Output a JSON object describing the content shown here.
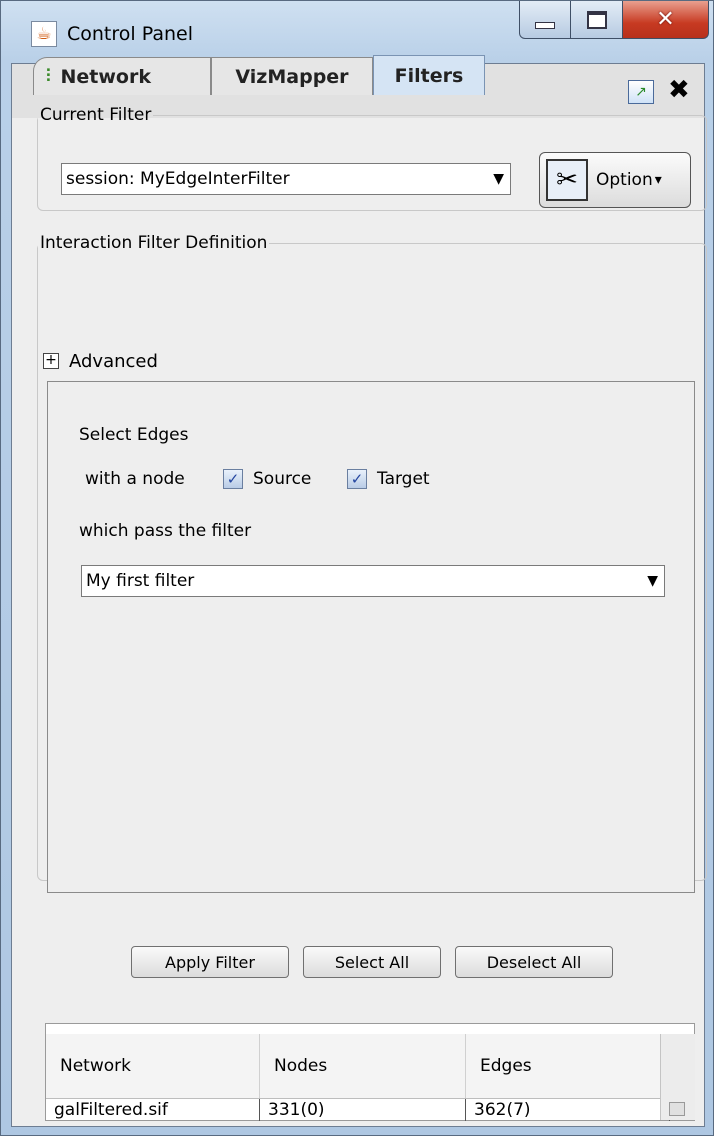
{
  "window": {
    "title": "Control Panel",
    "icon": "java-cup-icon",
    "controls": {
      "minimize": "minimize-icon",
      "maximize": "maximize-icon",
      "close": "✕"
    }
  },
  "panel": {
    "dock_icon": "undock-icon",
    "close_glyph": "✖"
  },
  "tabs": [
    {
      "label": "Network",
      "icon": "network-tree-icon",
      "active": false
    },
    {
      "label": "VizMapper",
      "active": false
    },
    {
      "label": "Filters",
      "active": true
    }
  ],
  "current_filter": {
    "legend": "Current Filter",
    "selected": "session: MyEdgeInterFilter",
    "option_button": "Option",
    "option_caret": "▾"
  },
  "interaction_filter": {
    "legend": "Interaction Filter Definition",
    "advanced_toggle": "+",
    "advanced_label": "Advanced",
    "select_edges": "Select Edges",
    "with_a_node": "with a node",
    "source_label": "Source",
    "source_checked": true,
    "target_label": "Target",
    "target_checked": true,
    "which_pass": "which pass the filter",
    "pass_filter_selected": "My first filter"
  },
  "actions": {
    "apply": "Apply Filter",
    "select_all": "Select All",
    "deselect_all": "Deselect All"
  },
  "table": {
    "columns": [
      "Network",
      "Nodes",
      "Edges"
    ],
    "rows": [
      [
        "galFiltered.sif",
        "331(0)",
        "362(7)"
      ]
    ]
  },
  "colors": {
    "window_frame": "#b9d0e8",
    "close_button": "#c73a22",
    "active_tab": "#d5e4f4",
    "panel_bg": "#eeeeee"
  }
}
